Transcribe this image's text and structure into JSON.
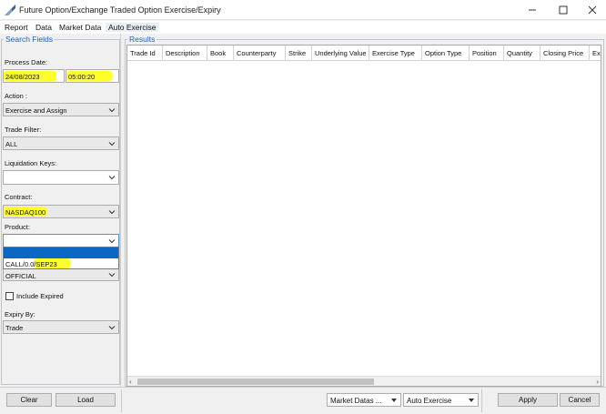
{
  "window": {
    "title": "Future Option/Exchange Traded Option Exercise/Expiry"
  },
  "menu": [
    "Report",
    "Data",
    "Market Data",
    "Auto Exercise"
  ],
  "search": {
    "group_title": "Search Fields",
    "process_date_label": "Process Date:",
    "process_date": "24/08/2023",
    "process_time": "05:00:20",
    "action_label": "Action :",
    "action_value": "Exercise and Assign",
    "trade_filter_label": "Trade Filter:",
    "trade_filter_value": "ALL",
    "liquidation_keys_label": "Liquidation Keys:",
    "liquidation_keys_value": "",
    "contract_label": "Contract:",
    "contract_value": "NASDAQ100",
    "product_label": "Product:",
    "product_value": "",
    "product_option": "CALL/0.0/SEP23",
    "price_source_value": "OFFICIAL",
    "include_expired_label": "Include Expired",
    "expiry_by_label": "Expiry By:",
    "expiry_by_value": "Trade"
  },
  "results": {
    "group_title": "Results",
    "columns": [
      "Trade Id",
      "Description",
      "Book",
      "Counterparty",
      "Strike",
      "Underlying Value",
      "Exercise Type",
      "Option Type",
      "Position",
      "Quantity",
      "Closing Price",
      "Exe"
    ]
  },
  "buttons": {
    "clear": "Clear",
    "load": "Load",
    "market_datas": "Market Datas ...",
    "auto_exercise": "Auto Exercise",
    "apply": "Apply",
    "cancel": "Cancel"
  },
  "colors": {
    "highlight": "#ffff2a",
    "group_title": "#1f5fbf",
    "selection": "#0a67c4"
  }
}
